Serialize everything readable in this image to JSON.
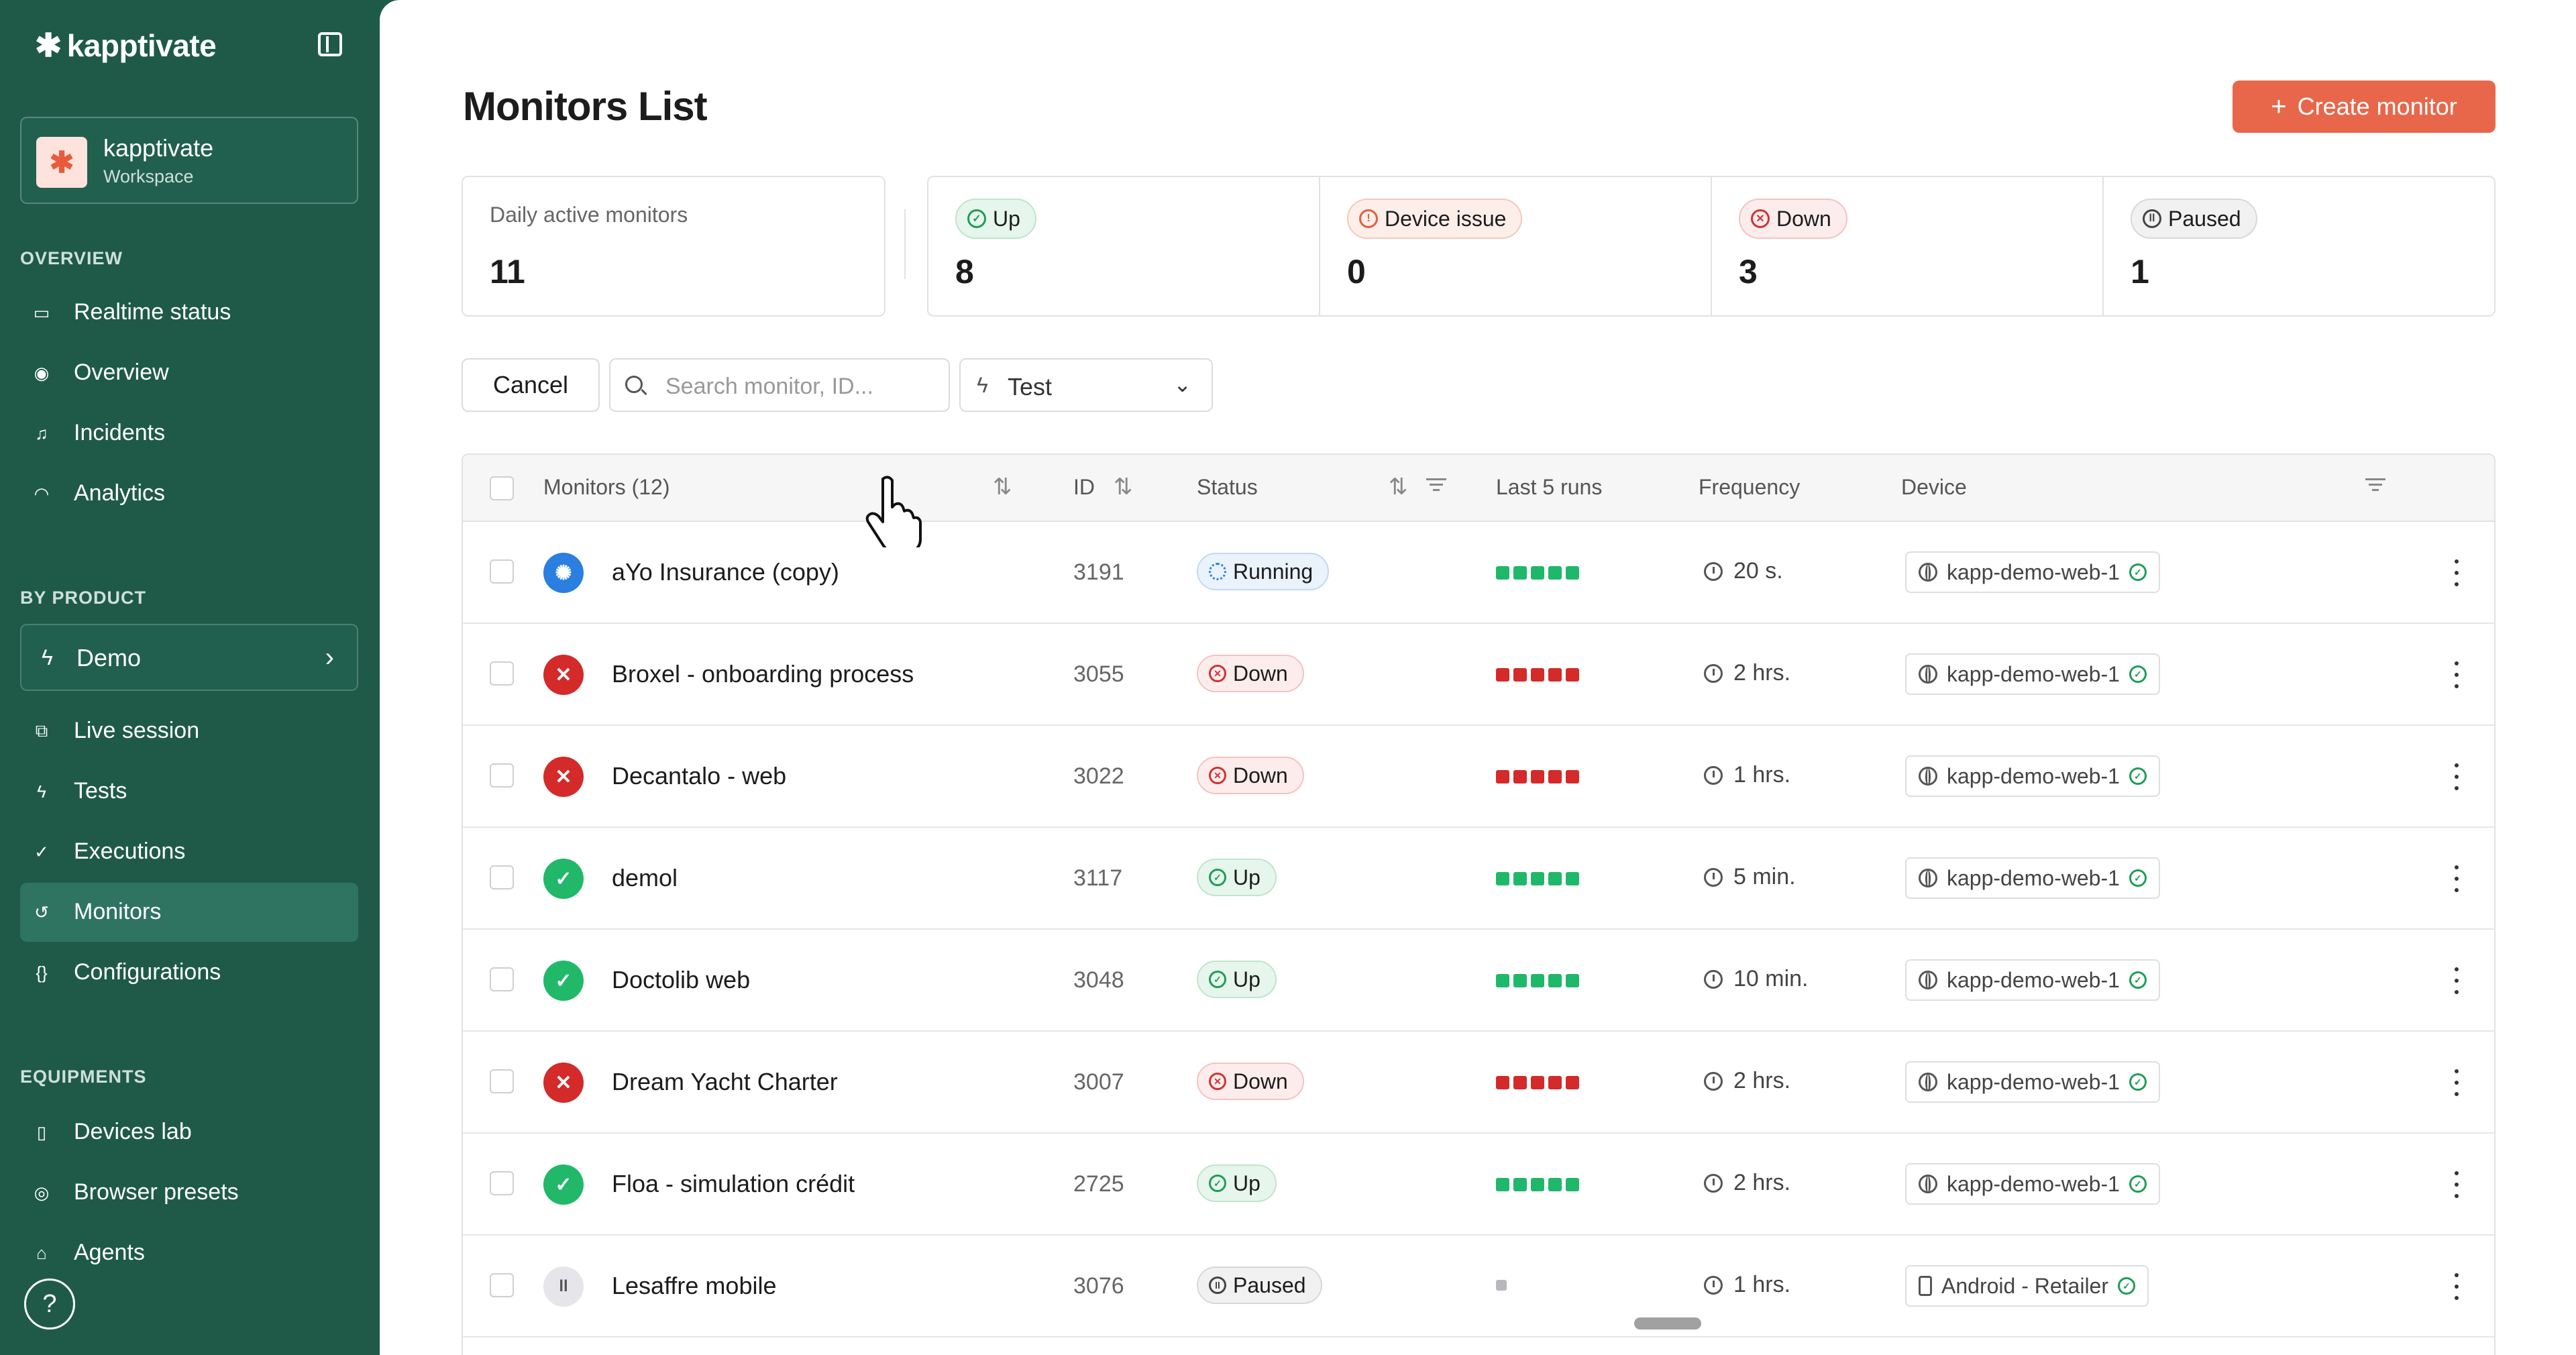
{
  "sidebar": {
    "brand": "kapptivate",
    "workspace": {
      "name": "kapptivate",
      "subtitle": "Workspace"
    },
    "sections": {
      "overview": "OVERVIEW",
      "by_product": "BY PRODUCT",
      "equipments": "EQUIPMENTS"
    },
    "overview_items": [
      {
        "label": "Realtime status",
        "icon": "monitor-icon"
      },
      {
        "label": "Overview",
        "icon": "eye-icon"
      },
      {
        "label": "Incidents",
        "icon": "bell-icon"
      },
      {
        "label": "Analytics",
        "icon": "gauge-icon"
      }
    ],
    "product": {
      "label": "Demo",
      "icon": "bolt-icon"
    },
    "product_items": [
      {
        "label": "Live session",
        "icon": "live-icon"
      },
      {
        "label": "Tests",
        "icon": "bolt-icon"
      },
      {
        "label": "Executions",
        "icon": "check-circle-icon"
      },
      {
        "label": "Monitors",
        "icon": "history-icon",
        "active": true
      },
      {
        "label": "Configurations",
        "icon": "braces-icon"
      }
    ],
    "equipment_items": [
      {
        "label": "Devices lab",
        "icon": "phone-icon"
      },
      {
        "label": "Browser presets",
        "icon": "browser-icon"
      },
      {
        "label": "Agents",
        "icon": "agent-icon"
      }
    ],
    "help": "?"
  },
  "page": {
    "title": "Monitors List",
    "create_label": "Create monitor"
  },
  "stats": {
    "daily_label": "Daily active monitors",
    "daily_value": "11",
    "up": {
      "label": "Up",
      "value": "8"
    },
    "issue": {
      "label": "Device issue",
      "value": "0"
    },
    "down": {
      "label": "Down",
      "value": "3"
    },
    "paused": {
      "label": "Paused",
      "value": "1"
    }
  },
  "toolbar": {
    "cancel_label": "Cancel",
    "search_placeholder": "Search monitor, ID...",
    "filter_value": "Test"
  },
  "table": {
    "headers": {
      "monitors": "Monitors (12)",
      "id": "ID",
      "status": "Status",
      "last_runs": "Last 5 runs",
      "frequency": "Frequency",
      "device": "Device"
    },
    "rows": [
      {
        "name": "aYo Insurance (copy)",
        "id": "3191",
        "status": "Running",
        "runs": [
          "green",
          "green",
          "green",
          "green",
          "green"
        ],
        "frequency": "20 s.",
        "device": "kapp-demo-web-1",
        "device_type": "web"
      },
      {
        "name": "Broxel - onboarding process",
        "id": "3055",
        "status": "Down",
        "runs": [
          "red",
          "red",
          "red",
          "red",
          "red"
        ],
        "frequency": "2 hrs.",
        "device": "kapp-demo-web-1",
        "device_type": "web"
      },
      {
        "name": "Decantalo - web",
        "id": "3022",
        "status": "Down",
        "runs": [
          "red",
          "red",
          "red",
          "red",
          "red"
        ],
        "frequency": "1 hrs.",
        "device": "kapp-demo-web-1",
        "device_type": "web"
      },
      {
        "name": "demol",
        "id": "3117",
        "status": "Up",
        "runs": [
          "green",
          "green",
          "green",
          "green",
          "green"
        ],
        "frequency": "5 min.",
        "device": "kapp-demo-web-1",
        "device_type": "web"
      },
      {
        "name": "Doctolib web",
        "id": "3048",
        "status": "Up",
        "runs": [
          "green",
          "green",
          "green",
          "green",
          "green"
        ],
        "frequency": "10 min.",
        "device": "kapp-demo-web-1",
        "device_type": "web"
      },
      {
        "name": "Dream Yacht Charter",
        "id": "3007",
        "status": "Down",
        "runs": [
          "red",
          "red",
          "red",
          "red",
          "red"
        ],
        "frequency": "2 hrs.",
        "device": "kapp-demo-web-1",
        "device_type": "web"
      },
      {
        "name": "Floa - simulation crédit",
        "id": "2725",
        "status": "Up",
        "runs": [
          "green",
          "green",
          "green",
          "green",
          "green"
        ],
        "frequency": "2 hrs.",
        "device": "kapp-demo-web-1",
        "device_type": "web"
      },
      {
        "name": "Lesaffre mobile",
        "id": "3076",
        "status": "Paused",
        "runs": [
          "gray"
        ],
        "frequency": "1 hrs.",
        "device": "Android - Retailer",
        "device_type": "mobile"
      }
    ]
  },
  "colors": {
    "brand": "#1f5a49",
    "accent": "#e8674a",
    "up": "#21b86a",
    "down": "#d42a2a",
    "running": "#2a7fe0",
    "run_green": "#1fb86a",
    "run_red": "#d42a2a",
    "run_gray": "#b8b8bc"
  }
}
